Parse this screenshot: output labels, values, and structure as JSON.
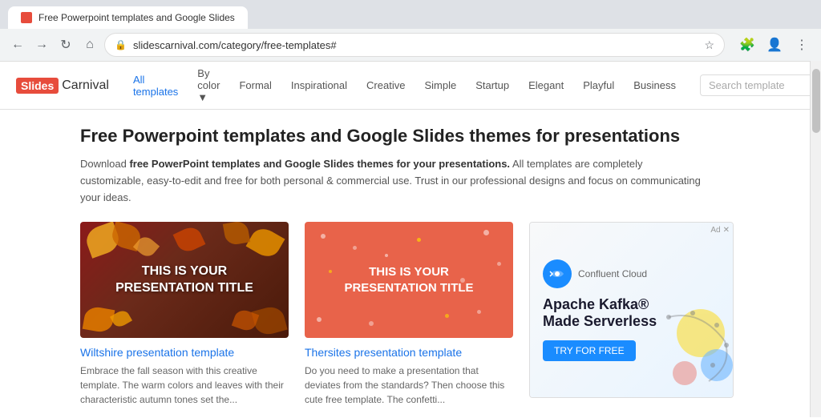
{
  "browser": {
    "url": "slidescarnival.com/category/free-templates#",
    "tab_title": "Free Powerpoint templates and Google Slides"
  },
  "header": {
    "logo_slides": "Slides",
    "logo_carnival": "Carnival",
    "nav_items": [
      {
        "label": "All templates",
        "active": true
      },
      {
        "label": "By color ▼",
        "active": false
      },
      {
        "label": "Formal",
        "active": false
      },
      {
        "label": "Inspirational",
        "active": false
      },
      {
        "label": "Creative",
        "active": false
      },
      {
        "label": "Simple",
        "active": false
      },
      {
        "label": "Startup",
        "active": false
      },
      {
        "label": "Elegant",
        "active": false
      },
      {
        "label": "Playful",
        "active": false
      },
      {
        "label": "Business",
        "active": false
      }
    ],
    "search_placeholder": "Search template"
  },
  "main": {
    "page_title": "Free Powerpoint templates and Google Slides themes for presentations",
    "page_description_normal": "Download ",
    "page_description_bold": "free PowerPoint templates and Google Slides themes for your presentations.",
    "page_description_rest": " All templates are completely customizable, easy-to-edit and free for both personal & commercial use. Trust in our professional designs and focus on communicating your ideas.",
    "templates": [
      {
        "id": "wiltshire",
        "thumb_text_line1": "THIS IS YOUR",
        "thumb_text_line2": "PRESENTATION TITLE",
        "thumb_type": "autumn",
        "title": "Wiltshire presentation template",
        "description": "Embrace the fall season with this creative template. The warm colors and leaves with their characteristic autumn tones set the..."
      },
      {
        "id": "thersites",
        "thumb_text_line1": "THIS IS YOUR",
        "thumb_text_line2": "PRESENTATION TITLE",
        "thumb_type": "coral",
        "title": "Thersites presentation template",
        "description": "Do you need to make a presentation that deviates from the standards? Then choose this cute free template. The confetti..."
      }
    ],
    "ad": {
      "badge": "Ad ✕",
      "brand": "Confluent Cloud",
      "headline_line1": "Apache Kafka®",
      "headline_line2": "Made Serverless",
      "cta": "TRY FOR FREE"
    }
  }
}
